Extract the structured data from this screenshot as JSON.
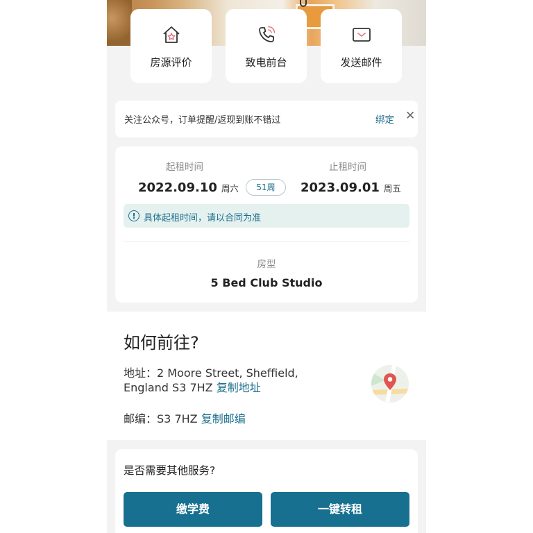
{
  "actions": [
    {
      "label": "房源评价",
      "icon": "house-star-icon"
    },
    {
      "label": "致电前台",
      "icon": "phone-call-icon"
    },
    {
      "label": "发送邮件",
      "icon": "envelope-icon"
    }
  ],
  "banner": {
    "text": "关注公众号，订单提醒/返现到账不错过",
    "bind_label": "绑定",
    "close_glyph": "✕"
  },
  "lease": {
    "start_label": "起租时间",
    "start_date": "2022.09.10",
    "start_weekday": "周六",
    "duration": "51周",
    "end_label": "止租时间",
    "end_date": "2023.09.01",
    "end_weekday": "周五",
    "note": "具体起租时间，请以合同为准",
    "room_type_label": "房型",
    "room_type": "5 Bed Club Studio"
  },
  "directions": {
    "title": "如何前往?",
    "address_prefix": "地址：",
    "address": "2 Moore Street, Sheffield, England S3 7HZ",
    "copy_address": "复制地址",
    "postcode_prefix": "邮编：",
    "postcode": "S3 7HZ",
    "copy_postcode": "复制邮编"
  },
  "services": {
    "question": "是否需要其他服务?",
    "pay_tuition": "缴学费",
    "transfer": "一键转租"
  },
  "colors": {
    "accent": "#1e6f8c",
    "button": "#17708f",
    "icon_pink": "#e9757c",
    "note_bg": "#e4f1ef"
  }
}
